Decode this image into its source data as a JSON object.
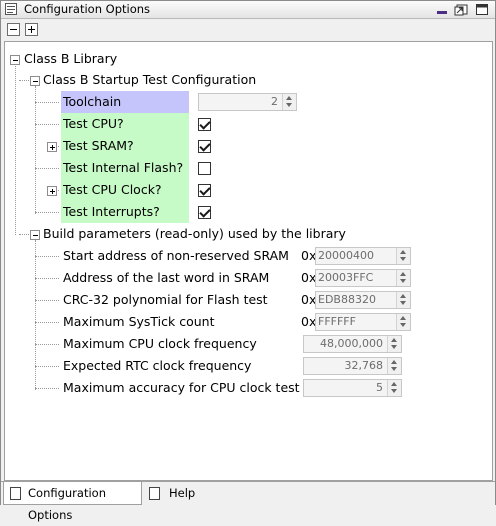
{
  "window": {
    "title": "Configuration Options"
  },
  "tree": {
    "root": {
      "label": "Class B Library"
    },
    "startup": {
      "label": "Class B Startup Test Configuration",
      "items": [
        {
          "label": "Toolchain",
          "value": "2"
        },
        {
          "label": "Test CPU?",
          "checked": true
        },
        {
          "label": "Test SRAM?",
          "checked": true
        },
        {
          "label": "Test Internal Flash?",
          "checked": false
        },
        {
          "label": "Test CPU Clock?",
          "checked": true
        },
        {
          "label": "Test Interrupts?",
          "checked": true
        }
      ]
    },
    "build": {
      "label": "Build parameters (read-only) used by the library",
      "hex_prefix": "0x",
      "items": [
        {
          "label": "Start address of non-reserved SRAM",
          "value": "20000400"
        },
        {
          "label": "Address of the last word in SRAM",
          "value": "20003FFC"
        },
        {
          "label": "CRC-32 polynomial for Flash test",
          "value": "EDB88320"
        },
        {
          "label": "Maximum SysTick count",
          "value": "FFFFFF"
        },
        {
          "label": "Maximum CPU clock frequency",
          "value": "48,000,000"
        },
        {
          "label": "Expected RTC clock frequency",
          "value": "32,768"
        },
        {
          "label": "Maximum accuracy for CPU clock test",
          "value": "5"
        }
      ]
    }
  },
  "tabs": [
    {
      "label": "Configuration Options"
    },
    {
      "label": "Help"
    }
  ],
  "colors": {
    "selected_row": "#c5c5fc",
    "editable_row": "#c6fac6"
  }
}
